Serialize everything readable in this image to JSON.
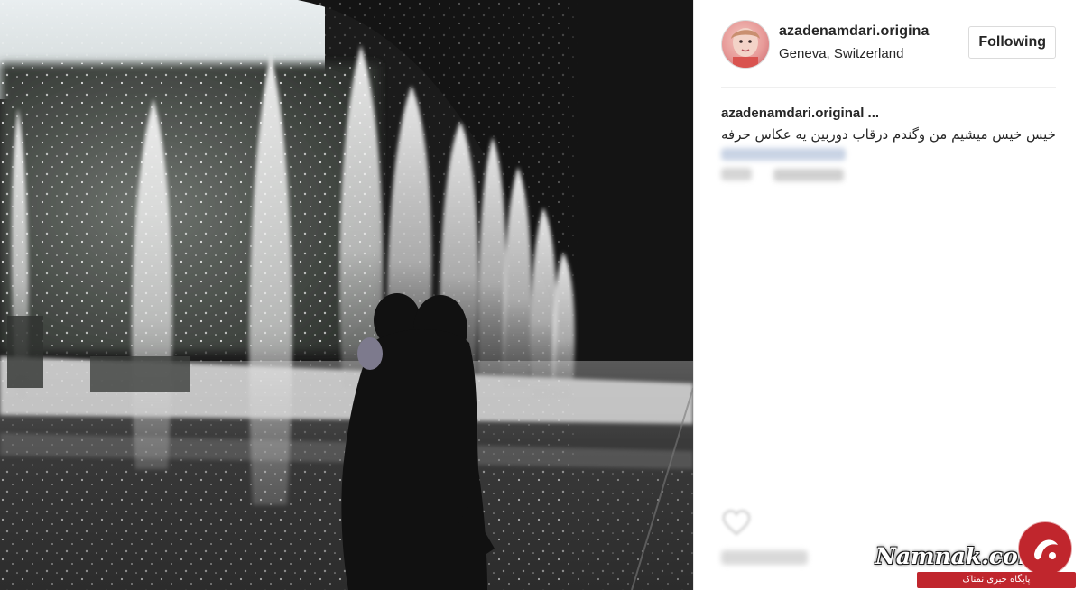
{
  "post": {
    "username": "azadenamdari.origina",
    "location": "Geneva, Switzerland",
    "follow_label": "Following",
    "caption_user": "azadenamdari.original ...",
    "caption_text": "خیس خیس میشیم من وگندم درقاب دوربین یه عکاس حرفه"
  },
  "watermark": {
    "site": "Namnak.com",
    "tagline": "پایگاه خبری نمناک"
  },
  "icons": {
    "heart": "heart-icon",
    "logo": "namnak-logo-icon"
  },
  "colors": {
    "brand_red": "#c0262d",
    "text": "#262626",
    "border": "#dbdbdb"
  }
}
